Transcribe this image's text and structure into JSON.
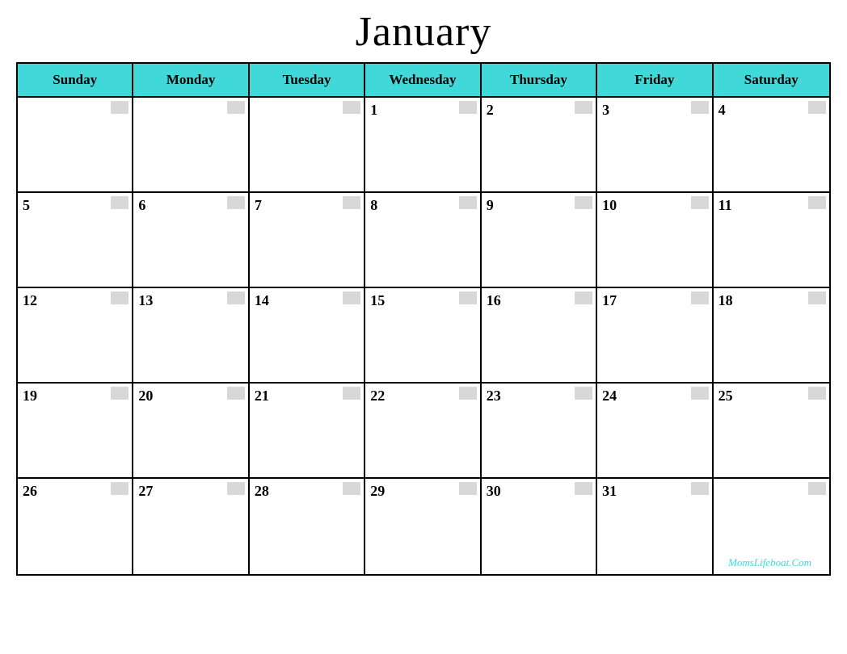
{
  "title": "January",
  "days_of_week": [
    "Sunday",
    "Monday",
    "Tuesday",
    "Wednesday",
    "Thursday",
    "Friday",
    "Saturday"
  ],
  "watermark": "MomsLifeboat.Com",
  "accent_color": "#40d8d8",
  "weeks": [
    [
      {
        "date": "",
        "empty": true
      },
      {
        "date": "",
        "empty": true
      },
      {
        "date": "",
        "empty": true
      },
      {
        "date": "1",
        "empty": false
      },
      {
        "date": "2",
        "empty": false
      },
      {
        "date": "3",
        "empty": false
      },
      {
        "date": "4",
        "empty": false
      }
    ],
    [
      {
        "date": "5",
        "empty": false
      },
      {
        "date": "6",
        "empty": false
      },
      {
        "date": "7",
        "empty": false
      },
      {
        "date": "8",
        "empty": false
      },
      {
        "date": "9",
        "empty": false
      },
      {
        "date": "10",
        "empty": false
      },
      {
        "date": "11",
        "empty": false
      }
    ],
    [
      {
        "date": "12",
        "empty": false
      },
      {
        "date": "13",
        "empty": false
      },
      {
        "date": "14",
        "empty": false
      },
      {
        "date": "15",
        "empty": false
      },
      {
        "date": "16",
        "empty": false
      },
      {
        "date": "17",
        "empty": false
      },
      {
        "date": "18",
        "empty": false
      }
    ],
    [
      {
        "date": "19",
        "empty": false
      },
      {
        "date": "20",
        "empty": false
      },
      {
        "date": "21",
        "empty": false
      },
      {
        "date": "22",
        "empty": false
      },
      {
        "date": "23",
        "empty": false
      },
      {
        "date": "24",
        "empty": false
      },
      {
        "date": "25",
        "empty": false
      }
    ],
    [
      {
        "date": "26",
        "empty": false
      },
      {
        "date": "27",
        "empty": false
      },
      {
        "date": "28",
        "empty": false
      },
      {
        "date": "29",
        "empty": false
      },
      {
        "date": "30",
        "empty": false
      },
      {
        "date": "31",
        "empty": false
      },
      {
        "date": "",
        "empty": true
      }
    ]
  ]
}
